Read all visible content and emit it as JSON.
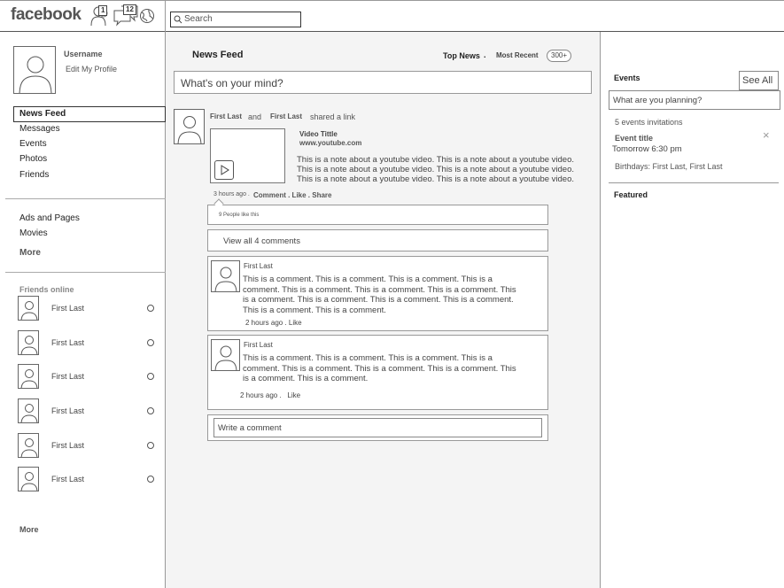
{
  "header": {
    "logo": "facebook",
    "friend_requests_count": "1",
    "messages_count": "12",
    "search_placeholder": "Search"
  },
  "profile": {
    "username": "Username",
    "edit_link": "Edit My Profile"
  },
  "sidebar": {
    "nav": [
      "News Feed",
      "Messages",
      "Events",
      "Photos",
      "Friends"
    ],
    "secondary": [
      "Ads and Pages",
      "Movies"
    ],
    "more1": "More",
    "friends_online_title": "Friends online",
    "friends": [
      "First Last",
      "First Last",
      "First Last",
      "First Last",
      "First Last",
      "First Last"
    ],
    "more2": "More"
  },
  "feed": {
    "title": "News Feed",
    "top_news": "Top News",
    "sep": ".",
    "most_recent": "Most Recent",
    "count_badge": "300+",
    "status_placeholder": "What's on your mind?",
    "post": {
      "author1": "First Last",
      "and": "and",
      "author2": "First Last",
      "action": "shared a link",
      "video_title": "Video Tittle",
      "video_url": "www.youtube.com",
      "note_lines": [
        "This is a note about a youtube video. This is a note about a youtube video.",
        "This is a note about a youtube video. This is a note about a youtube video.",
        "This is a note about a youtube video. This is a note about a youtube video."
      ],
      "time": "3 hours ago .",
      "actions": "Comment . Like . Share",
      "likes": "9 People like this",
      "view_all": "View all 4 comments",
      "comments": [
        {
          "name": "First Last",
          "lines": [
            "This is a comment. This is a comment. This is a comment. This is a",
            "comment. This is a comment. This is a comment. This is a comment. This",
            "is a comment. This is a comment. This is a comment. This is a comment.",
            "This is a comment. This is a comment."
          ],
          "meta": "2 hours ago . Like"
        },
        {
          "name": "First Last",
          "lines": [
            "This is a comment. This is a comment. This is a comment. This is a",
            "comment. This is a comment. This is a comment. This is a comment. This",
            "is a comment. This is a comment."
          ],
          "meta": "2 hours ago .   Like"
        }
      ],
      "write_comment": "Write a comment"
    }
  },
  "events": {
    "title": "Events",
    "see_all": "See All",
    "planning_placeholder": "What are you planning?",
    "invitations": "5 events invitations",
    "event_title": "Event title",
    "event_time": "Tomorrow 6:30 pm",
    "birthdays": "Birthdays: First Last, First Last",
    "featured": "Featured"
  }
}
